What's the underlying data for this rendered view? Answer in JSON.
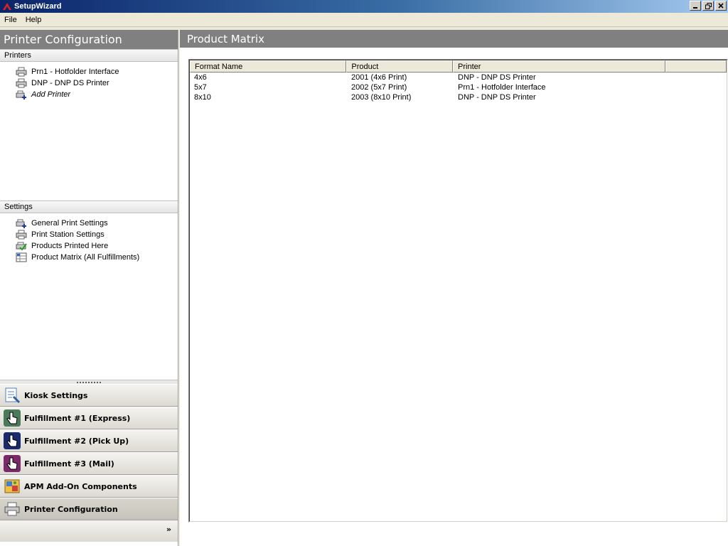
{
  "window": {
    "title": "SetupWizard"
  },
  "menu": [
    {
      "label": "File"
    },
    {
      "label": "Help"
    }
  ],
  "left": {
    "header": "Printer Configuration",
    "printers_section": "Printers",
    "printers": [
      {
        "label": "Prn1 - Hotfolder Interface",
        "icon": "printer-icon"
      },
      {
        "label": "DNP - DNP DS Printer",
        "icon": "printer-icon"
      },
      {
        "label": "Add Printer",
        "icon": "add-printer-icon"
      }
    ],
    "settings_section": "Settings",
    "settings": [
      {
        "label": "General Print Settings",
        "icon": "printer-add-icon"
      },
      {
        "label": "Print Station Settings",
        "icon": "printer-icon"
      },
      {
        "label": "Products Printed Here",
        "icon": "printer-check-icon"
      },
      {
        "label": "Product Matrix (All Fulfillments)",
        "icon": "matrix-icon"
      }
    ],
    "nav": [
      {
        "label": "Kiosk Settings",
        "icon": "kiosk-settings-icon"
      },
      {
        "label": "Fulfillment #1 (Express)",
        "icon": "hand-pointer-icon"
      },
      {
        "label": "Fulfillment #2 (Pick Up)",
        "icon": "hand-pointer-icon"
      },
      {
        "label": "Fulfillment #3 (Mail)",
        "icon": "hand-pointer-icon"
      },
      {
        "label": "APM Add-On Components",
        "icon": "photo-components-icon"
      },
      {
        "label": "Printer Configuration",
        "icon": "printer-icon"
      }
    ],
    "footer_chevron": "»"
  },
  "right": {
    "header": "Product Matrix",
    "columns": [
      "Format Name",
      "Product",
      "Printer",
      ""
    ],
    "rows": [
      [
        "4x6",
        "2001 (4x6 Print)",
        "DNP - DNP DS Printer"
      ],
      [
        "5x7",
        "2002 (5x7 Print)",
        "Prn1 - Hotfolder Interface"
      ],
      [
        "8x10",
        "2003 (8x10 Print)",
        "DNP - DNP DS Printer"
      ]
    ]
  },
  "colors": {
    "header_bg": "#808080",
    "titlebar_start": "#0a246a",
    "titlebar_end": "#a6caf0",
    "fulfillment1": "#4a7a5a",
    "fulfillment2": "#1a2a6a",
    "fulfillment3": "#7a2a6a"
  }
}
